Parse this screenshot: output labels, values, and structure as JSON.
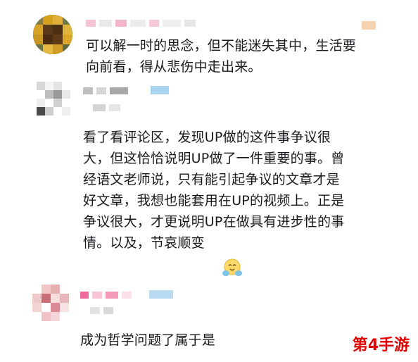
{
  "comments": [
    {
      "text": "可以解一时的思念，但不能迷失其中，生活要\n向前看，得从悲伤中走出来。"
    },
    {
      "text": "看了看评论区，发现UP做的这件事争议很\n大，但这恰恰说明UP做了一件重要的事。曾\n经语文老师说，只有能引起争议的文章才是\n好文章，我想也能套用在UP的视频上。正是\n争议很大，才更说明UP在做具有进步性的事\n情。以及，节哀顺变",
      "emoji": "hugging-face-icon"
    },
    {
      "text": "成为哲学问题了属于是"
    }
  ],
  "watermark": "第4手游",
  "colors": {
    "text": "#18191c",
    "watermark": "#e00000",
    "blur_pink": "#f5a6c4",
    "blur_blue": "#a9d4f0",
    "blur_gray": "#c9c9c9"
  }
}
